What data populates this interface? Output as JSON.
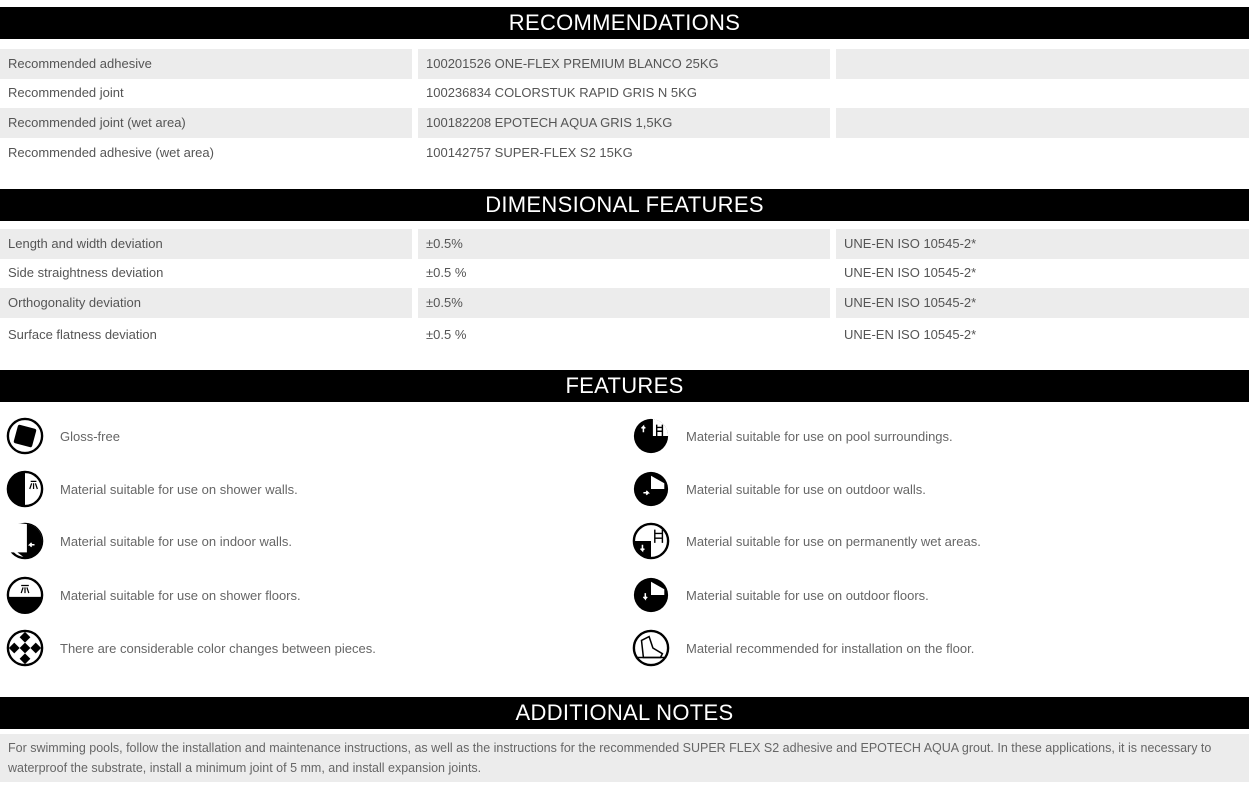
{
  "recommendations": {
    "title": "RECOMMENDATIONS",
    "rows": [
      {
        "label": "Recommended adhesive",
        "value": "100201526 ONE-FLEX PREMIUM BLANCO 25KG",
        "extra": ""
      },
      {
        "label": "Recommended joint",
        "value": "100236834 COLORSTUK RAPID GRIS N 5KG",
        "extra": ""
      },
      {
        "label": "Recommended joint (wet area)",
        "value": "100182208 EPOTECH AQUA GRIS 1,5KG",
        "extra": ""
      },
      {
        "label": "Recommended adhesive (wet area)",
        "value": "100142757 SUPER-FLEX S2 15KG",
        "extra": ""
      }
    ]
  },
  "dimensional": {
    "title": "DIMENSIONAL FEATURES",
    "rows": [
      {
        "label": "Length and width deviation",
        "value": "±0.5%",
        "standard": "UNE-EN ISO 10545-2*"
      },
      {
        "label": "Side straightness deviation",
        "value": "±0.5 %",
        "standard": "UNE-EN ISO 10545-2*"
      },
      {
        "label": "Orthogonality deviation",
        "value": "±0.5%",
        "standard": "UNE-EN ISO 10545-2*"
      },
      {
        "label": "Surface flatness deviation",
        "value": "±0.5 %",
        "standard": "UNE-EN ISO 10545-2*"
      }
    ]
  },
  "features": {
    "title": "FEATURES",
    "left": [
      {
        "icon": "gloss-free-icon",
        "text": "Gloss-free"
      },
      {
        "icon": "shower-wall-icon",
        "text": "Material suitable for use on shower walls."
      },
      {
        "icon": "indoor-wall-icon",
        "text": "Material suitable for use on indoor walls."
      },
      {
        "icon": "shower-floor-icon",
        "text": "Material suitable for use on shower floors."
      },
      {
        "icon": "color-variation-icon",
        "text": "There are considerable color changes between pieces."
      }
    ],
    "right": [
      {
        "icon": "pool-surroundings-icon",
        "text": "Material suitable for use on pool surroundings."
      },
      {
        "icon": "outdoor-wall-icon",
        "text": "Material suitable for use on outdoor walls."
      },
      {
        "icon": "wet-area-icon",
        "text": "Material suitable for use on permanently wet areas."
      },
      {
        "icon": "outdoor-floor-icon",
        "text": "Material suitable for use on outdoor floors."
      },
      {
        "icon": "floor-installation-icon",
        "text": "Material recommended for installation on the floor."
      }
    ]
  },
  "notes": {
    "title": "ADDITIONAL NOTES",
    "text": "For swimming pools, follow the installation and maintenance instructions, as well as the instructions for the recommended SUPER FLEX S2 adhesive and EPOTECH AQUA grout. In these applications, it is necessary to waterproof the substrate, install a minimum joint of 5 mm, and install expansion joints."
  },
  "colors": {
    "header_bg": "#000000",
    "header_text": "#ffffff",
    "row_shade": "#ececec",
    "body_text": "#555555"
  }
}
